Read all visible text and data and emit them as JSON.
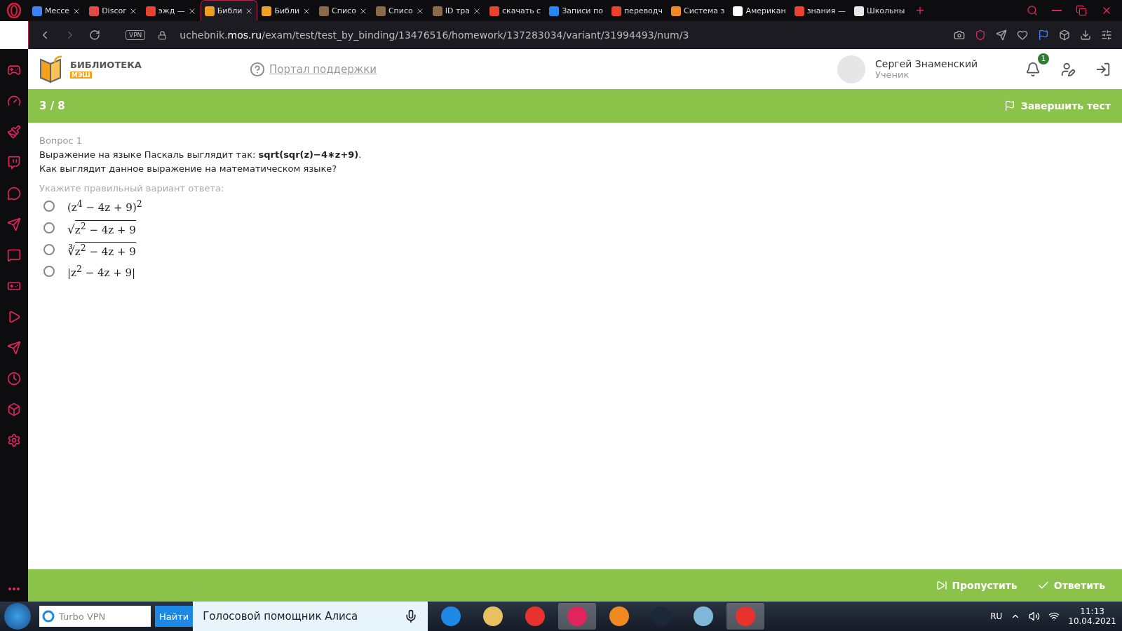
{
  "browser": {
    "tabs": [
      {
        "label": "Мессе",
        "selected": false,
        "color": "#3b82f6"
      },
      {
        "label": "Discor",
        "selected": false,
        "color": "#e24a4a"
      },
      {
        "label": "эжд —",
        "selected": false,
        "color": "#e8432e"
      },
      {
        "label": "Библи",
        "selected": true,
        "color": "#f0a020"
      },
      {
        "label": "Библи",
        "selected": false,
        "color": "#f0a020"
      },
      {
        "label": "Списо",
        "selected": false,
        "color": "#8a6a4a"
      },
      {
        "label": "Списо",
        "selected": false,
        "color": "#8a6a4a"
      },
      {
        "label": "ID тра",
        "selected": false,
        "color": "#8a6a4a"
      },
      {
        "label": "скачать с",
        "selected": false,
        "color": "#e8432e"
      },
      {
        "label": "Записи по",
        "selected": false,
        "color": "#2787f5"
      },
      {
        "label": "переводч",
        "selected": false,
        "color": "#e8432e"
      },
      {
        "label": "Система з",
        "selected": false,
        "color": "#f08a20"
      },
      {
        "label": "Американ",
        "selected": false,
        "color": "#ffffff"
      },
      {
        "label": "знания —",
        "selected": false,
        "color": "#e8432e"
      },
      {
        "label": "Школьны",
        "selected": false,
        "color": "#e8e8e8"
      }
    ],
    "vpn": "VPN",
    "url": "uchebnik.**mos.ru**/exam/test/test_by_binding/13476516/homework/137283034/variant/31994493/num/3"
  },
  "header": {
    "logo_title": "БИБЛИОТЕКА",
    "logo_badge": "МЭШ",
    "support_link": "Портал поддержки",
    "user_name": "Сергей Знаменский",
    "user_role": "Ученик",
    "notifications": "1"
  },
  "progress_bar": {
    "counter": "3 / 8",
    "finish_button": "Завершить тест"
  },
  "question": {
    "number": "Вопрос 1",
    "text": "Выражение на языке Паскаль выглядит так: **sqrt(sqr(z)−4∗z+9)**.",
    "text_2": "Как выглядит данное выражение на математическом языке?",
    "hint": "Укажите правильный вариант ответа:",
    "options": [
      {
        "expr": "(z$^{4}$ − 4z + 9)$^{2}$",
        "selected": false
      },
      {
        "radical": "√",
        "expr": "z$^{2}$ − 4z + 9",
        "selected": false
      },
      {
        "radical": "∛",
        "expr": "z$^{2}$ − 4z + 9",
        "selected": false
      },
      {
        "expr": "|z$^{2}$ − 4z + 9|",
        "selected": false
      }
    ]
  },
  "footer": {
    "skip_button": "Пропустить",
    "answer_button": "Ответить"
  },
  "taskbar": {
    "search_placeholder": "Turbo VPN",
    "search_button": "Найти",
    "assistant": "Голосовой помощник Алиса",
    "language": "RU",
    "time": "11:13",
    "date": "10.04.2021"
  }
}
